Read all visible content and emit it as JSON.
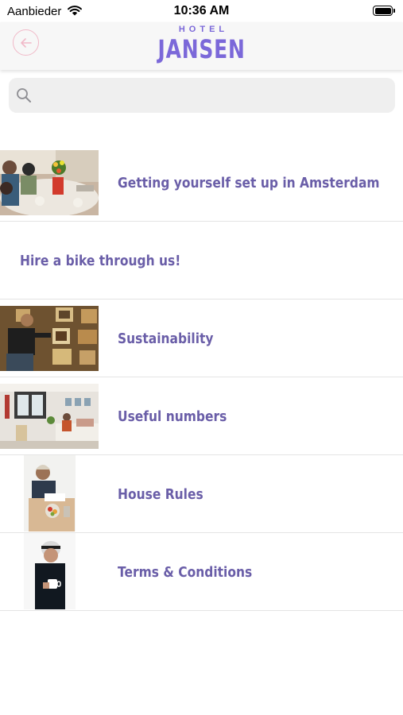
{
  "status_bar": {
    "carrier": "Aanbieder",
    "time": "10:36 AM"
  },
  "header": {
    "logo_top": "HOTEL",
    "logo_main": "JANSEN",
    "brand_color": "#7b68d9",
    "back_icon": "arrow-left-icon"
  },
  "search": {
    "placeholder": "",
    "value": ""
  },
  "colors": {
    "label": "#6a5ea8",
    "divider": "#e4e4e4",
    "back_button": "#f1b9c8"
  },
  "items": [
    {
      "label": "Getting yourself set up in Amsterdam",
      "image": "group-dinner-photo"
    },
    {
      "label": "Hire a bike through us!",
      "image": ""
    },
    {
      "label": "Sustainability",
      "image": "man-at-gallery-wall-photo"
    },
    {
      "label": "Useful numbers",
      "image": "hotel-room-photo"
    },
    {
      "label": "House Rules",
      "image": "man-reading-at-table-photo"
    },
    {
      "label": "Terms & Conditions",
      "image": "man-with-mug-photo"
    }
  ]
}
